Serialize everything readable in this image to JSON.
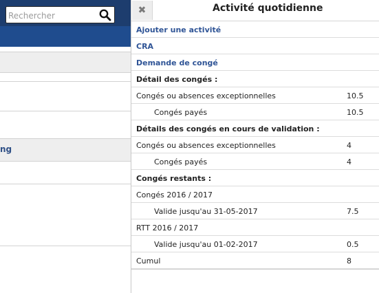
{
  "search": {
    "placeholder": "Rechercher",
    "icon": "magnifier-icon"
  },
  "background": {
    "link_fragment": "ng"
  },
  "panel": {
    "close_glyph": "✖",
    "title": "Activité quotidienne",
    "rows": [
      {
        "label": "Ajouter une activité",
        "value": ""
      },
      {
        "label": "CRA",
        "value": ""
      },
      {
        "label": "Demande de congé",
        "value": ""
      },
      {
        "label": "Détail des congés :",
        "value": ""
      },
      {
        "label": "Congés ou absences exceptionnelles",
        "value": "10.5"
      },
      {
        "label": "Congés payés",
        "value": "10.5"
      },
      {
        "label": "Détails des congés en cours de validation :",
        "value": ""
      },
      {
        "label": "Congés ou absences exceptionnelles",
        "value": "4"
      },
      {
        "label": "Congés payés",
        "value": "4"
      },
      {
        "label": "Congés restants :",
        "value": ""
      },
      {
        "label": "Congés 2016 / 2017",
        "value": ""
      },
      {
        "label": "Valide jusqu'au 31-05-2017",
        "value": "7.5"
      },
      {
        "label": "RTT 2016 / 2017",
        "value": ""
      },
      {
        "label": "Valide jusqu'au 01-02-2017",
        "value": "0.5"
      },
      {
        "label": "Cumul",
        "value": "8"
      }
    ]
  },
  "colors": {
    "topbar": "#1d3d6e",
    "subbar": "#1f4c8e",
    "link": "#2f5496"
  }
}
